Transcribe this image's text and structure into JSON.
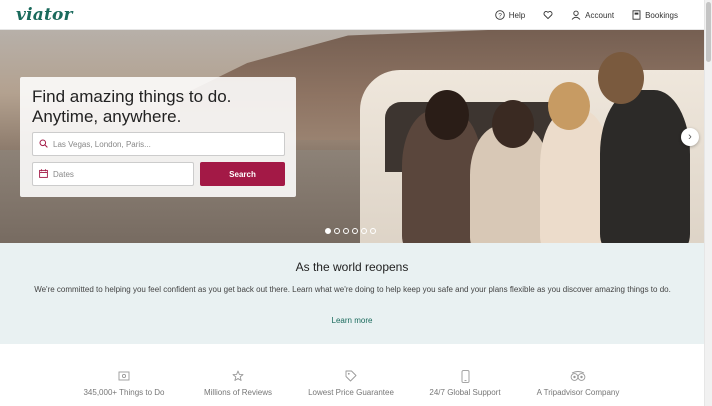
{
  "header": {
    "logo": "viator",
    "nav": {
      "help": "Help",
      "account": "Account",
      "bookings": "Bookings"
    }
  },
  "hero": {
    "headline_line1": "Find amazing things to do.",
    "headline_line2": "Anytime, anywhere.",
    "where_placeholder": "Las Vegas, London, Paris...",
    "dates_placeholder": "Dates",
    "search_label": "Search",
    "slides": 6,
    "active_slide": 1,
    "next_glyph": "›"
  },
  "reopen": {
    "title": "As the world reopens",
    "body": "We're committed to helping you feel confident as you get back out there. Learn what we're doing to help keep you safe and your plans flexible as you discover amazing things to do.",
    "learn_more": "Learn more"
  },
  "features": [
    {
      "label": "345,000+ Things to Do",
      "icon": "ticket-icon"
    },
    {
      "label": "Millions of Reviews",
      "icon": "star-icon"
    },
    {
      "label": "Lowest Price Guarantee",
      "icon": "tag-icon"
    },
    {
      "label": "24/7 Global Support",
      "icon": "phone-icon"
    },
    {
      "label": "A Tripadvisor Company",
      "icon": "tripadvisor-owl-icon"
    }
  ],
  "colors": {
    "brand": "#1a6a5c",
    "search_button": "#a31946",
    "reopen_background": "#e9f1f2"
  }
}
